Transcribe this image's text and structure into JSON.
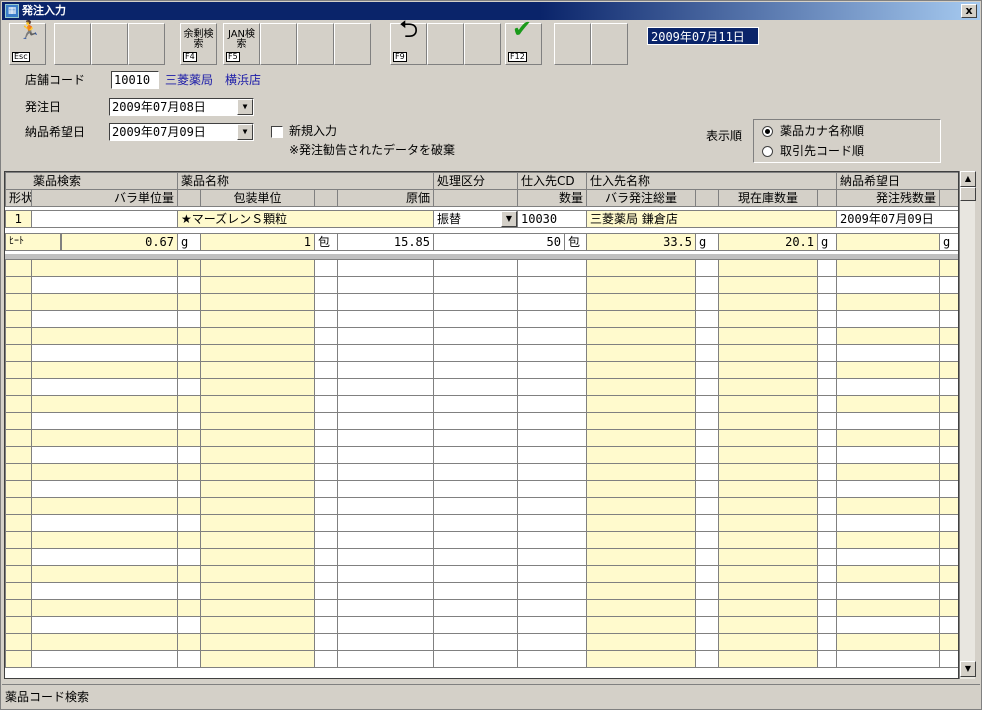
{
  "window": {
    "title": "発注入力",
    "close": "x"
  },
  "toolbar": {
    "buttons": [
      {
        "key": "Esc",
        "label": ""
      },
      {
        "key": "",
        "label": ""
      },
      {
        "key": "",
        "label": ""
      },
      {
        "key": "",
        "label": ""
      },
      {
        "key": "F4",
        "label": "余剰検索"
      },
      {
        "key": "F5",
        "label": "JAN検索"
      },
      {
        "key": "",
        "label": ""
      },
      {
        "key": "",
        "label": ""
      },
      {
        "key": "",
        "label": ""
      },
      {
        "key": "F9",
        "label": ""
      },
      {
        "key": "",
        "label": ""
      },
      {
        "key": "",
        "label": ""
      },
      {
        "key": "F12",
        "label": ""
      },
      {
        "key": "",
        "label": ""
      },
      {
        "key": "",
        "label": ""
      }
    ],
    "date": "2009年07月11日"
  },
  "form": {
    "store_label": "店舗コード",
    "store_code": "10010",
    "store_name": "三菱薬局　横浜店",
    "order_date_label": "発注日",
    "order_date": "2009年07月08日",
    "delivery_label": "納品希望日",
    "delivery_date": "2009年07月09日",
    "new_input_label": "新規入力",
    "note": "※発注勧告されたデータを破棄",
    "sort_label": "表示順",
    "sort_options": [
      "薬品カナ名称順",
      "取引先コード順"
    ],
    "sort_selected": 0
  },
  "grid": {
    "header1": [
      "薬品検索",
      "薬品名称",
      "処理区分",
      "仕入先CD",
      "仕入先名称",
      "納品希望日"
    ],
    "header2": [
      "形状",
      "バラ単位量",
      "包装単位",
      "原価",
      "数量",
      "バラ発注総量",
      "現在庫数量",
      "発注残数量"
    ],
    "row1": {
      "no": "1",
      "drug_name": "★マーズレンＳ顆粒",
      "process": "振替",
      "supplier_cd": "10030",
      "supplier_name": "三菱薬局 鎌倉店",
      "delivery_date": "2009年07月09日"
    },
    "row2": {
      "shape": "ﾋｰﾄ",
      "unit_qty": "0.67",
      "unit": "g",
      "pack_unit": "1",
      "pack_label": "包",
      "cost": "15.85",
      "qty": "50",
      "qty_unit": "包",
      "total": "33.5",
      "total_unit": "g",
      "stock": "20.1",
      "stock_unit": "g",
      "backorder_unit": "g"
    }
  },
  "status": "薬品コード検索"
}
